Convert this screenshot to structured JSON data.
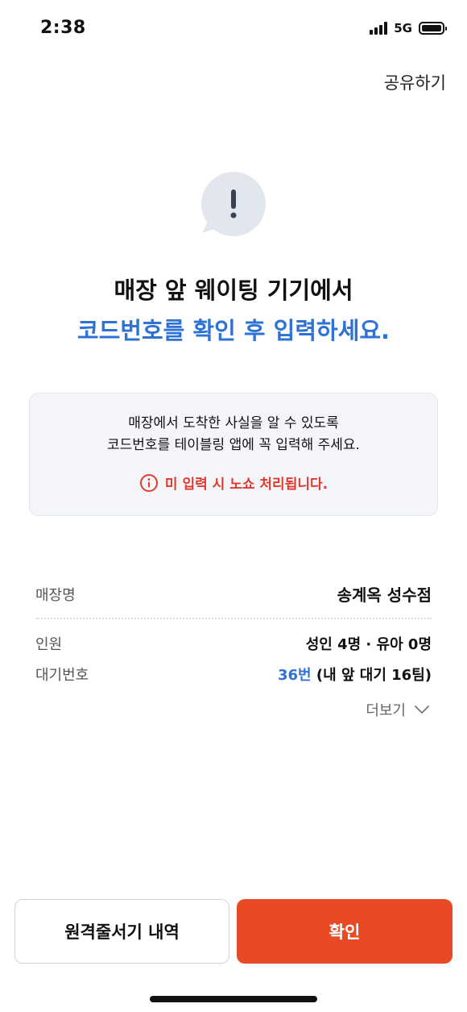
{
  "status_bar": {
    "time": "2:38",
    "network": "5G"
  },
  "header": {
    "share_label": "공유하기"
  },
  "headline": {
    "line1": "매장 앞 웨이팅 기기에서",
    "line2": "코드번호를 확인 후 입력하세요."
  },
  "notice": {
    "line1": "매장에서 도착한 사실을 알 수 있도록",
    "line2": "코드번호를 테이블링 앱에 꼭 입력해 주세요.",
    "warning": "미 입력 시 노쇼 처리됩니다."
  },
  "info": {
    "store_label": "매장명",
    "store_value": "송계옥 성수점",
    "people_label": "인원",
    "people_value": "성인 4명 · 유아 0명",
    "wait_label": "대기번호",
    "wait_number": "36번",
    "wait_detail": "(내 앞 대기 16팀)",
    "more_label": "더보기"
  },
  "buttons": {
    "history_label": "원격줄서기 내역",
    "confirm_label": "확인"
  },
  "colors": {
    "accent_blue": "#2f72d6",
    "warning_red": "#e03a2e",
    "confirm_orange": "#e84a26"
  }
}
